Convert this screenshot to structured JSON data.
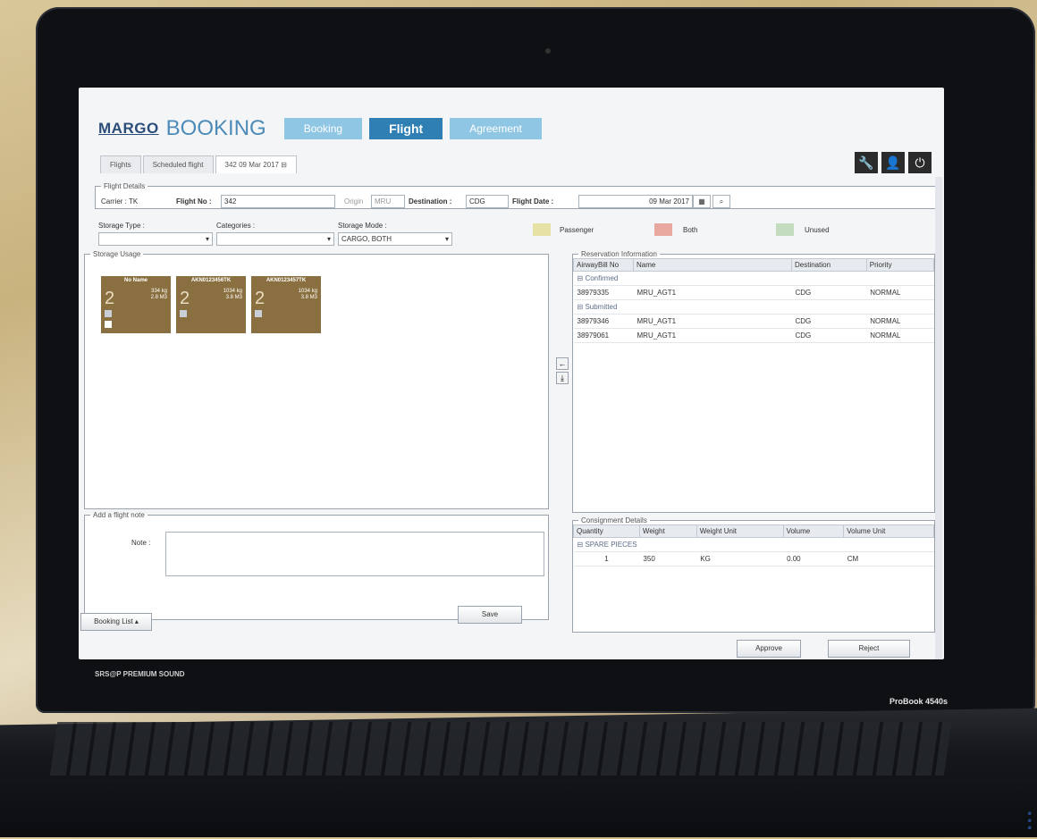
{
  "app": {
    "logo_margo": "MARGO",
    "logo_booking": "BOOKING",
    "nav": [
      "Booking",
      "Flight",
      "Agreement"
    ]
  },
  "tabs": [
    "Flights",
    "Scheduled flight",
    "342 09 Mar 2017"
  ],
  "flight_details": {
    "legend": "Flight Details",
    "carrier": "Carrier : TK",
    "flight_no_label": "Flight No :",
    "flight_no": "342",
    "origin_label": "Origin",
    "origin": "MRU",
    "destination_label": "Destination :",
    "destination": "CDG",
    "flight_date_label": "Flight Date :",
    "flight_date": "09 Mar 2017"
  },
  "filters": {
    "storage_type_label": "Storage Type :",
    "categories_label": "Categories :",
    "storage_mode_label": "Storage Mode :",
    "storage_mode": "CARGO, BOTH"
  },
  "legend_keys": [
    {
      "label": "Passenger",
      "color": "#e6e2a6"
    },
    {
      "label": "Both",
      "color": "#e8a8a0"
    },
    {
      "label": "Unused",
      "color": "#c3dcc0"
    }
  ],
  "storage_usage": {
    "legend": "Storage Usage",
    "cards": [
      {
        "title": "No Name",
        "count": "2",
        "weight": "334 kg",
        "volume": "2.8 M3"
      },
      {
        "title": "AKN0123456TK",
        "count": "2",
        "weight": "1034 kg",
        "volume": "3.8 M3"
      },
      {
        "title": "AKN0123457TK",
        "count": "2",
        "weight": "1034 kg",
        "volume": "3.8 M3"
      }
    ]
  },
  "reservation": {
    "legend": "Reservation Information",
    "columns": [
      "AirwayBill No",
      "Name",
      "Destination",
      "Priority"
    ],
    "groups": [
      {
        "name": "Confirmed",
        "rows": [
          [
            "38979335",
            "MRU_AGT1",
            "CDG",
            "NORMAL"
          ]
        ]
      },
      {
        "name": "Submitted",
        "rows": [
          [
            "38979346",
            "MRU_AGT1",
            "CDG",
            "NORMAL"
          ],
          [
            "38979061",
            "MRU_AGT1",
            "CDG",
            "NORMAL"
          ]
        ]
      }
    ]
  },
  "note": {
    "legend": "Add a flight note",
    "label": "Note :",
    "save": "Save"
  },
  "consignment": {
    "legend": "Consignment Details",
    "columns": [
      "Quantity",
      "Weight",
      "Weight Unit",
      "Volume",
      "Volume Unit"
    ],
    "group": "SPARE PIECES",
    "row": [
      "1",
      "350",
      "KG",
      "0.00",
      "CM"
    ]
  },
  "footer": {
    "booking_list": "Booking List",
    "approve": "Approve",
    "reject": "Reject"
  },
  "bezel": {
    "brand": "SRS@P PREMIUM SOUND",
    "model": "ProBook 4540s"
  }
}
